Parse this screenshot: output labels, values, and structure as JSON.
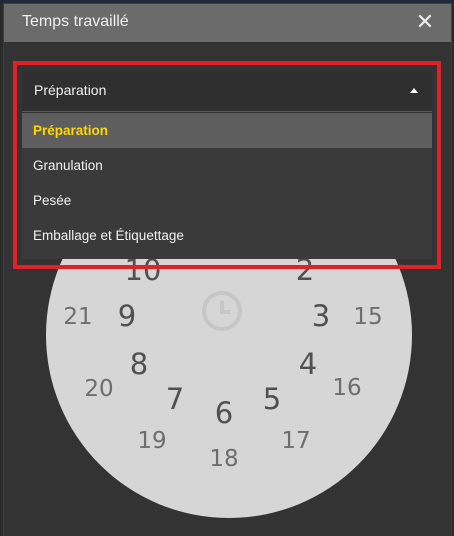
{
  "dialog": {
    "title": "Temps travaillé",
    "close_glyph": "✕"
  },
  "combo": {
    "selected": "Préparation",
    "options": [
      "Préparation",
      "Granulation",
      "Pesée",
      "Emballage et Étiquettage"
    ]
  },
  "clock": {
    "icon": "clock-icon",
    "inner_numbers": [
      "10",
      "2",
      "9",
      "3",
      "8",
      "4",
      "7",
      "5",
      "6"
    ],
    "outer_numbers": [
      "21",
      "15",
      "20",
      "16",
      "19",
      "17",
      "18"
    ]
  },
  "colors": {
    "title_bar": "#6b6b6b",
    "dialog_bg": "#333333",
    "selected_text": "#ffd700",
    "highlight_frame": "#e2202a",
    "clock_face": "#d6d6d6"
  }
}
